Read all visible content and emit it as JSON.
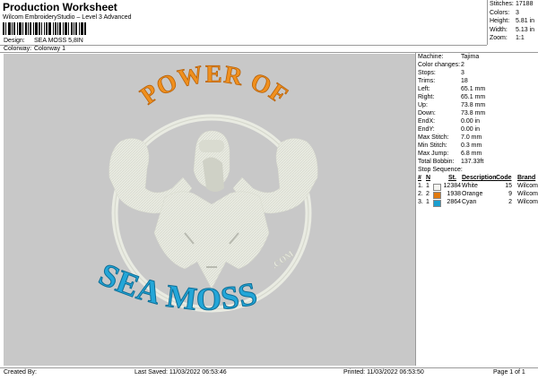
{
  "header": {
    "title": "Production Worksheet",
    "subtitle": "Wilcom EmbroideryStudio – Level 3 Advanced",
    "design_label": "Design:",
    "design_value": "SEA MOSS 5,8IN",
    "colorway_label": "Colorway:",
    "colorway_value": "Colorway 1"
  },
  "summary": [
    {
      "label": "Stitches:",
      "value": "17188"
    },
    {
      "label": "Colors:",
      "value": "3"
    },
    {
      "label": "Height:",
      "value": "5.81 in"
    },
    {
      "label": "Width:",
      "value": "5.13 in"
    },
    {
      "label": "Zoom:",
      "value": "1:1"
    }
  ],
  "details": [
    {
      "label": "Machine:",
      "value": "Tajima"
    },
    {
      "label": "Color changes:",
      "value": "2"
    },
    {
      "label": "Stops:",
      "value": "3"
    },
    {
      "label": "Trims:",
      "value": "18"
    },
    {
      "label": "Left:",
      "value": "65.1 mm"
    },
    {
      "label": "Right:",
      "value": "65.1 mm"
    },
    {
      "label": "Up:",
      "value": "73.8 mm"
    },
    {
      "label": "Down:",
      "value": "73.8 mm"
    },
    {
      "label": "EndX:",
      "value": "0.00 in"
    },
    {
      "label": "EndY:",
      "value": "0.00 in"
    },
    {
      "label": "Max Stitch:",
      "value": "7.0 mm"
    },
    {
      "label": "Min Stitch:",
      "value": "0.3 mm"
    },
    {
      "label": "Max Jump:",
      "value": "6.8 mm"
    },
    {
      "label": "Total Bobbin:",
      "value": "137.33ft"
    }
  ],
  "stop_sequence": {
    "title": "Stop Sequence:",
    "headers": [
      "#",
      "N",
      "St.",
      "Description",
      "Code",
      "Brand"
    ],
    "rows": [
      {
        "num": "1.",
        "n": "1",
        "color": "#f4f4f0",
        "st": "12384",
        "desc": "White",
        "code": "15",
        "brand": "Wilcom"
      },
      {
        "num": "2.",
        "n": "2",
        "color": "#e07a10",
        "st": "1938",
        "desc": "Orange",
        "code": "9",
        "brand": "Wilcom"
      },
      {
        "num": "3.",
        "n": "1",
        "color": "#1a9fd0",
        "st": "2864",
        "desc": "Cyan",
        "code": "2",
        "brand": "Wilcom"
      }
    ]
  },
  "design": {
    "top_text": "POWER OF",
    "bottom_text": "SEA MOSS",
    "com_text": ".COM",
    "colors": {
      "white": "#e9ebe2",
      "orange": "#f0901e",
      "cyan": "#23a6d8",
      "background": "#c8c8c8"
    }
  },
  "footer": {
    "created_by": "Created By:",
    "last_saved": "Last Saved: 11/03/2022 06:53:46",
    "printed": "Printed: 11/03/2022 06:53:50",
    "page": "Page 1 of 1"
  }
}
